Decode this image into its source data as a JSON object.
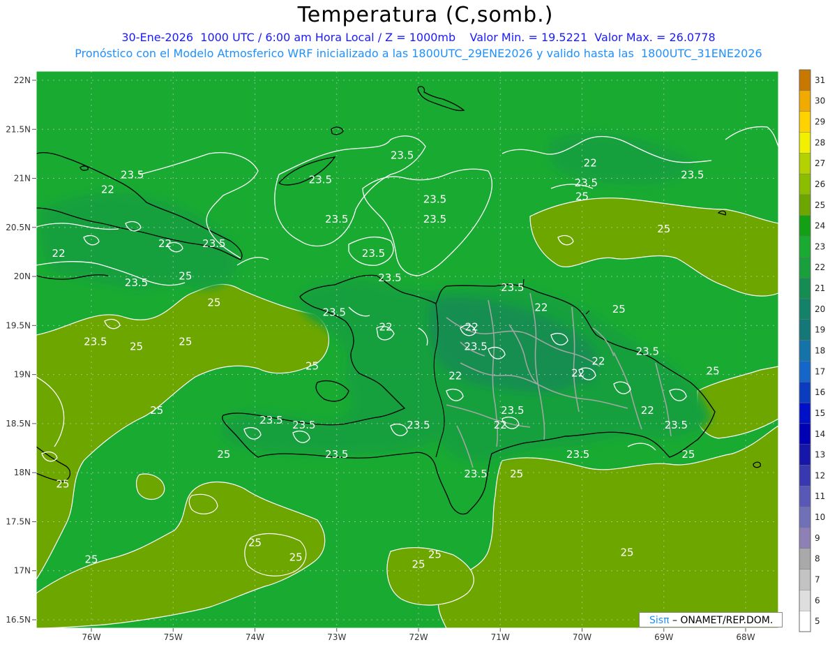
{
  "title": "Temperatura (C,somb.)",
  "subtitle_line1": "30-Ene-2026  1000 UTC / 6:00 am Hora Local / Z = 1000mb    Valor Min. = 19.5221  Valor Max. = 26.0778",
  "subtitle_line2": "Pronóstico con el Modelo Atmosferico WRF inicializado a las 1800UTC_29ENE2026 y valido hasta las  1800UTC_31ENE2026",
  "credit": {
    "brand": "Sisπ",
    "text": " – ONAMET/REP.DOM."
  },
  "lat_labels": [
    "22N",
    "21.5N",
    "21N",
    "20.5N",
    "20N",
    "19.5N",
    "19N",
    "18.5N",
    "18N",
    "17.5N",
    "17N",
    "16.5N"
  ],
  "lon_labels": [
    "76W",
    "75W",
    "74W",
    "73W",
    "72W",
    "71W",
    "70W",
    "69W",
    "68W"
  ],
  "colorbar": [
    {
      "value": "5",
      "color": "#ffffff"
    },
    {
      "value": "6",
      "color": "#dedede"
    },
    {
      "value": "7",
      "color": "#c3c3c3"
    },
    {
      "value": "8",
      "color": "#a9a9a9"
    },
    {
      "value": "9",
      "color": "#8e7fb5"
    },
    {
      "value": "10",
      "color": "#7070b8"
    },
    {
      "value": "11",
      "color": "#5858b6"
    },
    {
      "value": "12",
      "color": "#3838b0"
    },
    {
      "value": "13",
      "color": "#1616aa"
    },
    {
      "value": "14",
      "color": "#0000b4"
    },
    {
      "value": "15",
      "color": "#0010c8"
    },
    {
      "value": "16",
      "color": "#0a3cc0"
    },
    {
      "value": "17",
      "color": "#1466c8"
    },
    {
      "value": "18",
      "color": "#1474aa"
    },
    {
      "value": "19",
      "color": "#147878"
    },
    {
      "value": "20",
      "color": "#148268"
    },
    {
      "value": "21",
      "color": "#148c52"
    },
    {
      "value": "22",
      "color": "#17a03c"
    },
    {
      "value": "23",
      "color": "#19aa32"
    },
    {
      "value": "24",
      "color": "#14a014"
    },
    {
      "value": "25",
      "color": "#6ea600"
    },
    {
      "value": "26",
      "color": "#8cbe00"
    },
    {
      "value": "27",
      "color": "#b4d200"
    },
    {
      "value": "28",
      "color": "#f0f000"
    },
    {
      "value": "29",
      "color": "#ffd200"
    },
    {
      "value": "30",
      "color": "#f0aa00"
    },
    {
      "value": "31",
      "color": "#c87800"
    }
  ],
  "field_colors": {
    "base": "#19aa32",
    "warm": "#6ea600",
    "cool": "#17a03c",
    "cooler": "#148c52"
  },
  "contour_labels": [
    {
      "text": "23.5",
      "lon": -75.5,
      "lat": 21.0
    },
    {
      "text": "22",
      "lon": -75.8,
      "lat": 20.85
    },
    {
      "text": "22",
      "lon": -76.4,
      "lat": 20.2
    },
    {
      "text": "22",
      "lon": -75.1,
      "lat": 20.3
    },
    {
      "text": "23.5",
      "lon": -74.5,
      "lat": 20.3
    },
    {
      "text": "23.5",
      "lon": -75.45,
      "lat": 19.9
    },
    {
      "text": "25",
      "lon": -74.85,
      "lat": 19.97
    },
    {
      "text": "25",
      "lon": -74.5,
      "lat": 19.7
    },
    {
      "text": "23.5",
      "lon": -75.95,
      "lat": 19.3
    },
    {
      "text": "25",
      "lon": -75.45,
      "lat": 19.25
    },
    {
      "text": "25",
      "lon": -74.85,
      "lat": 19.3
    },
    {
      "text": "25",
      "lon": -76.35,
      "lat": 17.85
    },
    {
      "text": "25",
      "lon": -75.2,
      "lat": 18.6
    },
    {
      "text": "25",
      "lon": -74.38,
      "lat": 18.15
    },
    {
      "text": "23.5",
      "lon": -73.8,
      "lat": 18.5
    },
    {
      "text": "23.5",
      "lon": -73.4,
      "lat": 18.45
    },
    {
      "text": "23.5",
      "lon": -73.0,
      "lat": 18.15
    },
    {
      "text": "25",
      "lon": -73.3,
      "lat": 19.05
    },
    {
      "text": "23.5",
      "lon": -73.03,
      "lat": 19.6
    },
    {
      "text": "23.5",
      "lon": -73.2,
      "lat": 20.95
    },
    {
      "text": "23.5",
      "lon": -73.0,
      "lat": 20.55
    },
    {
      "text": "23.5",
      "lon": -72.55,
      "lat": 20.2
    },
    {
      "text": "23.5",
      "lon": -72.35,
      "lat": 19.95
    },
    {
      "text": "23.5",
      "lon": -72.2,
      "lat": 21.2
    },
    {
      "text": "23.5",
      "lon": -71.8,
      "lat": 20.75
    },
    {
      "text": "23.5",
      "lon": -71.8,
      "lat": 20.55
    },
    {
      "text": "22",
      "lon": -72.4,
      "lat": 19.45
    },
    {
      "text": "22",
      "lon": -71.35,
      "lat": 19.45
    },
    {
      "text": "23.5",
      "lon": -71.3,
      "lat": 19.25
    },
    {
      "text": "22",
      "lon": -71.55,
      "lat": 18.95
    },
    {
      "text": "23.5",
      "lon": -70.85,
      "lat": 19.85
    },
    {
      "text": "22",
      "lon": -70.5,
      "lat": 19.65
    },
    {
      "text": "22",
      "lon": -69.8,
      "lat": 19.1
    },
    {
      "text": "22",
      "lon": -70.05,
      "lat": 18.98
    },
    {
      "text": "23.5",
      "lon": -70.85,
      "lat": 18.6
    },
    {
      "text": "22",
      "lon": -71.0,
      "lat": 18.45
    },
    {
      "text": "23.5",
      "lon": -72.0,
      "lat": 18.45
    },
    {
      "text": "23.5",
      "lon": -71.3,
      "lat": 17.95
    },
    {
      "text": "25",
      "lon": -70.8,
      "lat": 17.95
    },
    {
      "text": "23.5",
      "lon": -70.05,
      "lat": 18.15
    },
    {
      "text": "22",
      "lon": -69.2,
      "lat": 18.6
    },
    {
      "text": "23.5",
      "lon": -68.85,
      "lat": 18.45
    },
    {
      "text": "23.5",
      "lon": -69.2,
      "lat": 19.2
    },
    {
      "text": "25",
      "lon": -68.4,
      "lat": 19.0
    },
    {
      "text": "25",
      "lon": -68.7,
      "lat": 18.15
    },
    {
      "text": "25",
      "lon": -69.55,
      "lat": 19.63
    },
    {
      "text": "25",
      "lon": -69.0,
      "lat": 20.45
    },
    {
      "text": "22",
      "lon": -69.9,
      "lat": 21.12
    },
    {
      "text": "23.5",
      "lon": -69.95,
      "lat": 20.92
    },
    {
      "text": "25",
      "lon": -70.0,
      "lat": 20.78
    },
    {
      "text": "23.5",
      "lon": -68.65,
      "lat": 21.0
    },
    {
      "text": "25",
      "lon": -74.0,
      "lat": 17.25
    },
    {
      "text": "25",
      "lon": -73.5,
      "lat": 17.1
    },
    {
      "text": "25",
      "lon": -76.0,
      "lat": 17.08
    },
    {
      "text": "25",
      "lon": -72.0,
      "lat": 17.03
    },
    {
      "text": "25",
      "lon": -71.8,
      "lat": 17.13
    },
    {
      "text": "25",
      "lon": -69.45,
      "lat": 17.15
    }
  ]
}
